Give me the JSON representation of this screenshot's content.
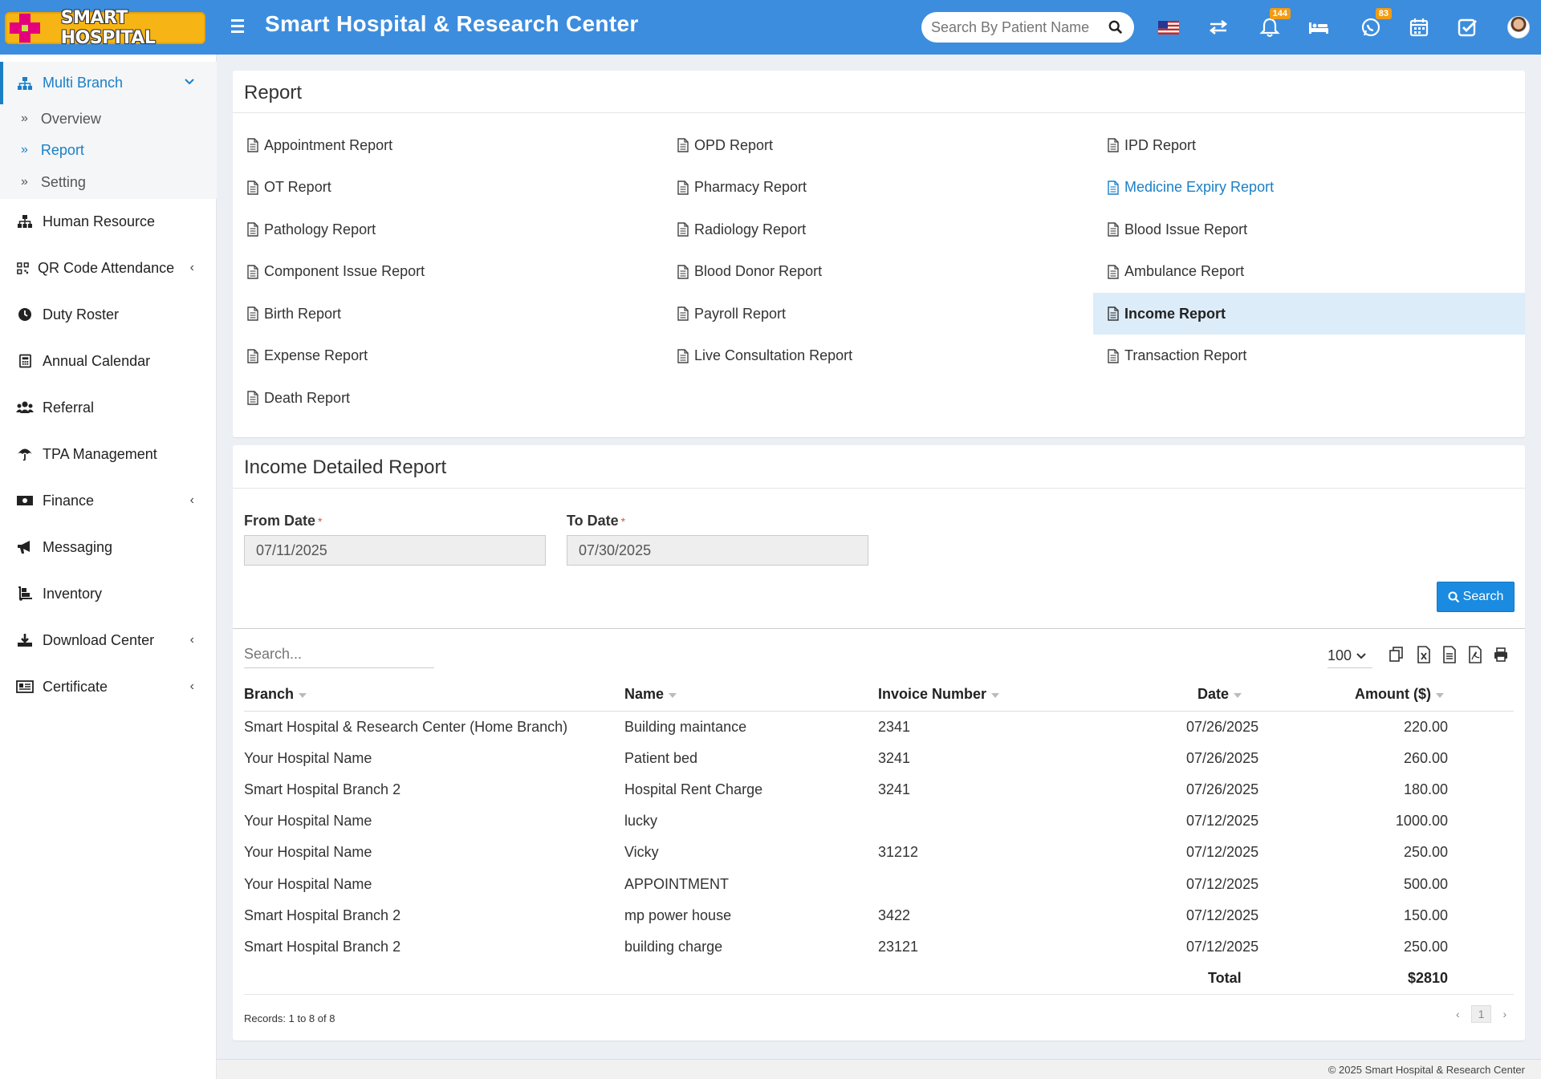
{
  "app": {
    "logo_text": "SMART HOSPITAL",
    "title": "Smart Hospital & Research Center",
    "search_placeholder": "Search By Patient Name",
    "notification_count": "144",
    "whatsapp_count": "83"
  },
  "sidebar": {
    "multi_branch": "Multi Branch",
    "sub_items": [
      "Overview",
      "Report",
      "Setting"
    ],
    "items": [
      "Human Resource",
      "QR Code Attendance",
      "Duty Roster",
      "Annual Calendar",
      "Referral",
      "TPA Management",
      "Finance",
      "Messaging",
      "Inventory",
      "Download Center",
      "Certificate"
    ]
  },
  "report": {
    "title": "Report",
    "links": [
      [
        "Appointment Report",
        "OPD Report",
        "IPD Report"
      ],
      [
        "OT Report",
        "Pharmacy Report",
        "Medicine Expiry Report"
      ],
      [
        "Pathology Report",
        "Radiology Report",
        "Blood Issue Report"
      ],
      [
        "Component Issue Report",
        "Blood Donor Report",
        "Ambulance Report"
      ],
      [
        "Birth Report",
        "Payroll Report",
        "Income Report"
      ],
      [
        "Expense Report",
        "Live Consultation Report",
        "Transaction Report"
      ],
      [
        "Death Report"
      ]
    ]
  },
  "income": {
    "title": "Income Detailed Report",
    "from_label": "From Date",
    "from_value": "07/11/2025",
    "to_label": "To Date",
    "to_value": "07/30/2025",
    "search_button": "Search",
    "table_search_placeholder": "Search...",
    "page_size": "100",
    "columns": [
      "Branch",
      "Name",
      "Invoice Number",
      "Date",
      "Amount ($)"
    ],
    "rows": [
      [
        "Smart Hospital & Research Center (Home Branch)",
        "Building maintance",
        "2341",
        "07/26/2025",
        "220.00"
      ],
      [
        "Your Hospital Name",
        "Patient bed",
        "3241",
        "07/26/2025",
        "260.00"
      ],
      [
        "Smart Hospital Branch 2",
        "Hospital Rent Charge",
        "3241",
        "07/26/2025",
        "180.00"
      ],
      [
        "Your Hospital Name",
        "lucky",
        "",
        "07/12/2025",
        "1000.00"
      ],
      [
        "Your Hospital Name",
        "Vicky",
        "31212",
        "07/12/2025",
        "250.00"
      ],
      [
        "Your Hospital Name",
        "APPOINTMENT",
        "",
        "07/12/2025",
        "500.00"
      ],
      [
        "Smart Hospital Branch 2",
        "mp power house",
        "3422",
        "07/12/2025",
        "150.00"
      ],
      [
        "Smart Hospital Branch 2",
        "building charge",
        "23121",
        "07/12/2025",
        "250.00"
      ]
    ],
    "total_label": "Total",
    "total_value": "$2810",
    "records_text": "Records: 1 to 8 of 8",
    "current_page": "1"
  },
  "footer": {
    "copyright": "© 2025 Smart Hospital & Research Center"
  },
  "colors": {
    "header": "#3c8dde",
    "accent": "#1a7fc6",
    "badge": "#f39c12"
  }
}
